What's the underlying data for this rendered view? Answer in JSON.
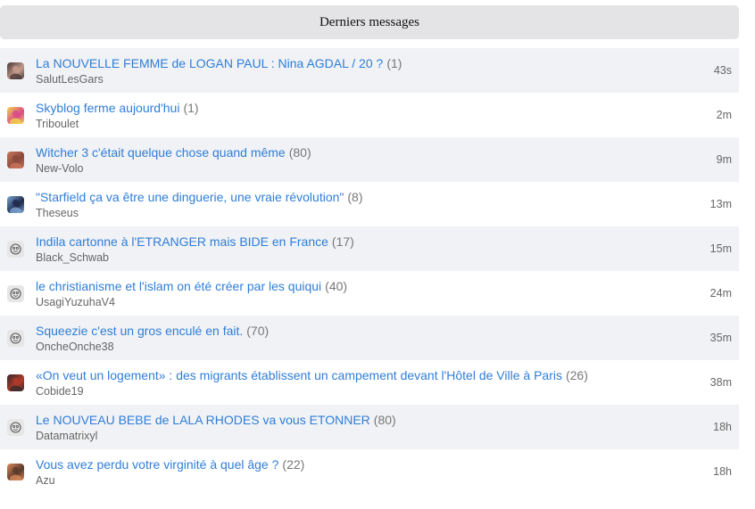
{
  "header": {
    "title": "Derniers messages"
  },
  "topics": [
    {
      "title": "La NOUVELLE FEMME de LOGAN PAUL : Nina AGDAL / 20 ?",
      "count": "(1)",
      "author": "SalutLesGars",
      "time": "43s",
      "avatar": "photo-woman-icon",
      "avatar_colors": [
        "#4a3a3a",
        "#c59b8b"
      ]
    },
    {
      "title": "Skyblog ferme aujourd'hui",
      "count": "(1)",
      "author": "Triboulet",
      "time": "2m",
      "avatar": "jester-icon",
      "avatar_colors": [
        "#f2d64b",
        "#d94a8a"
      ]
    },
    {
      "title": "Witcher 3 c'était quelque chose quand même",
      "count": "(80)",
      "author": "New-Volo",
      "time": "9m",
      "avatar": "photo-face-icon",
      "avatar_colors": [
        "#c9765a",
        "#8a4a3a"
      ]
    },
    {
      "title": "\"Starfield ça va être une dinguerie, une vraie révolution\"",
      "count": "(8)",
      "author": "Theseus",
      "time": "13m",
      "avatar": "photo-figure-icon",
      "avatar_colors": [
        "#7fa7d8",
        "#1e2a4a"
      ]
    },
    {
      "title": "Indila cartonne à l'ETRANGER mais BIDE en France",
      "count": "(17)",
      "author": "Black_Schwab",
      "time": "15m",
      "avatar": "default-smiley-icon",
      "avatar_colors": [
        "#e6e6e6",
        "#555555"
      ]
    },
    {
      "title": "le christianisme et l'islam on été créer par les quiqui",
      "count": "(40)",
      "author": "UsagiYuzuhaV4",
      "time": "24m",
      "avatar": "default-smiley-icon",
      "avatar_colors": [
        "#e6e6e6",
        "#555555"
      ]
    },
    {
      "title": "Squeezie c'est un gros enculé en fait.",
      "count": "(70)",
      "author": "OncheOnche38",
      "time": "35m",
      "avatar": "default-smiley-icon",
      "avatar_colors": [
        "#e6e6e6",
        "#555555"
      ]
    },
    {
      "title": "«On veut un logement» : des migrants établissent un campement devant l'Hôtel de Ville à Paris",
      "count": "(26)",
      "author": "Cobide19",
      "time": "38m",
      "avatar": "photo-dark-icon",
      "avatar_colors": [
        "#3a2a2a",
        "#b03a2a"
      ]
    },
    {
      "title": "Le NOUVEAU BEBE de LALA RHODES va vous ETONNER",
      "count": "(80)",
      "author": "Datamatrixyl",
      "time": "18h",
      "avatar": "default-smiley-icon",
      "avatar_colors": [
        "#e6e6e6",
        "#555555"
      ]
    },
    {
      "title": "Vous avez perdu votre virginité à quel âge ?",
      "count": "(22)",
      "author": "Azu",
      "time": "18h",
      "avatar": "photo-man-icon",
      "avatar_colors": [
        "#d98a5a",
        "#5a3a2a"
      ]
    }
  ]
}
